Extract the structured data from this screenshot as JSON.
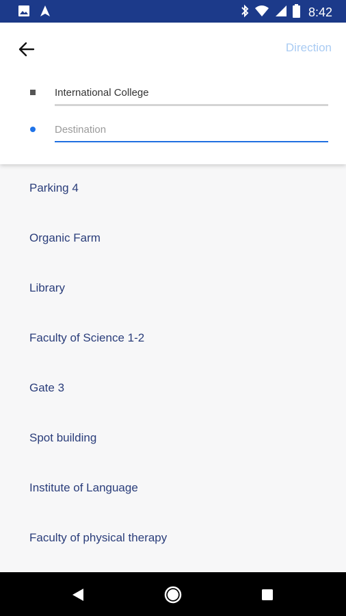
{
  "status_bar": {
    "time": "8:42",
    "icons": [
      "image-icon",
      "navigation-icon",
      "bluetooth-icon",
      "wifi-icon",
      "signal-icon",
      "battery-icon"
    ]
  },
  "header": {
    "direction_label": "Direction",
    "origin_value": "International College",
    "destination_placeholder": "Destination",
    "accent_color": "#1f6fe0"
  },
  "places": [
    "Parking 4",
    "Organic Farm",
    "Library",
    "Faculty of Science 1-2",
    "Gate 3",
    "Spot building",
    "Institute of Language",
    "Faculty of physical therapy"
  ],
  "nav_bar": {
    "icons": [
      "back-triangle-icon",
      "home-circle-icon",
      "recents-square-icon"
    ]
  }
}
